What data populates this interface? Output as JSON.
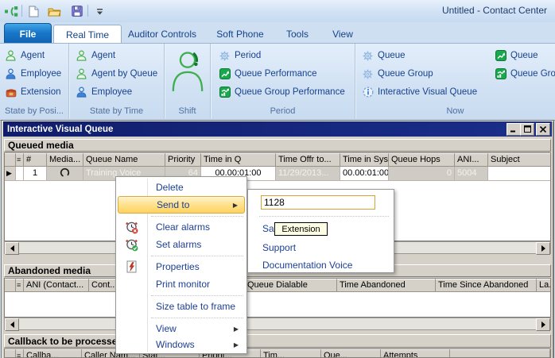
{
  "app": {
    "title": "Untitled - Contact Center"
  },
  "tabs": {
    "file": "File",
    "items": [
      "Real Time",
      "Auditor Controls",
      "Soft Phone",
      "Tools",
      "View"
    ],
    "active": "Real Time"
  },
  "ribbon": {
    "state_by_position": {
      "label": "State by Posi...",
      "items": [
        "Agent",
        "Employee",
        "Extension"
      ]
    },
    "state_by_time": {
      "label": "State by Time",
      "items": [
        "Agent",
        "Agent by Queue",
        "Employee"
      ]
    },
    "shift": {
      "label": "Shift"
    },
    "period": {
      "label": "Period",
      "items": [
        "Period",
        "Queue Performance",
        "Queue Group Performance"
      ]
    },
    "now": {
      "label": "Now",
      "col1": [
        "Queue",
        "Queue Group",
        "Interactive Visual Queue"
      ],
      "col2": [
        "Queue",
        "Queue Group"
      ]
    }
  },
  "window": {
    "title": "Interactive Visual Queue"
  },
  "queued_media": {
    "title": "Queued media",
    "columns": [
      "#",
      "Media...",
      "Queue Name",
      "Priority",
      "Time in Q",
      "Time Offr to...",
      "Time in Sys",
      "Queue Hops",
      "ANI...",
      "Subject"
    ],
    "rows": [
      {
        "num": "1",
        "media": "voice",
        "queue_name": "Training Voice",
        "priority": "64",
        "time_in_q": "00.00:01:00",
        "time_offr_to": "11/29/2013...",
        "time_in_sys": "00.00:01:00",
        "queue_hops": "0",
        "ani": "5004",
        "subject": ""
      }
    ]
  },
  "abandoned_media": {
    "title": "Abandoned media",
    "columns": [
      "ANI (Contact...",
      "Cont...",
      "Queue Dialable",
      "Time Abandoned",
      "Time Since Abandoned",
      "La..."
    ]
  },
  "callback": {
    "title": "Callback to be processed",
    "columns": [
      "Callba...",
      "Caller Nam...",
      "Stat...",
      "Priorit...",
      "Tim...",
      "Que...",
      "Attempts"
    ]
  },
  "context_menu": {
    "items": [
      {
        "label": "Delete"
      },
      {
        "label": "Send to"
      },
      {
        "label": "Clear alarms"
      },
      {
        "label": "Set alarms"
      },
      {
        "label": "Properties"
      },
      {
        "label": "Print monitor"
      },
      {
        "label": "Size table to frame"
      },
      {
        "label": "View"
      },
      {
        "label": "Windows"
      }
    ]
  },
  "send_to_submenu": {
    "input_value": "1128",
    "items": [
      "Sales",
      "Support",
      "Documentation Voice"
    ]
  },
  "tooltip": {
    "text": "Extension"
  },
  "colors": {
    "accent_blue": "#15428b",
    "window_title_bar": "#101d6b",
    "menu_highlight": "#ffd25e",
    "alarm_red": "#d23222",
    "ok_green": "#2ea84a"
  }
}
